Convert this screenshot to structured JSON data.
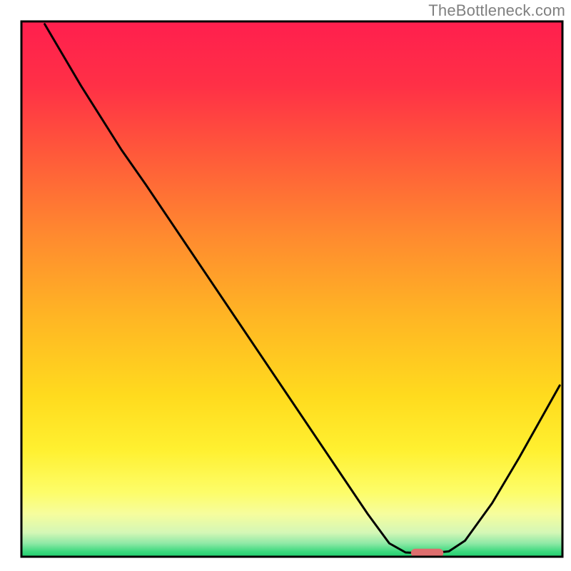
{
  "watermark": "TheBottleneck.com",
  "chart_data": {
    "type": "line",
    "title": "",
    "xlabel": "",
    "ylabel": "",
    "xlim": [
      0,
      100
    ],
    "ylim": [
      0,
      100
    ],
    "background_gradient": {
      "stops": [
        {
          "offset": 0.0,
          "color": "#ff1f4e"
        },
        {
          "offset": 0.12,
          "color": "#ff3046"
        },
        {
          "offset": 0.25,
          "color": "#ff5a3a"
        },
        {
          "offset": 0.4,
          "color": "#ff8a2f"
        },
        {
          "offset": 0.55,
          "color": "#ffb524"
        },
        {
          "offset": 0.7,
          "color": "#ffdb1e"
        },
        {
          "offset": 0.8,
          "color": "#fff030"
        },
        {
          "offset": 0.88,
          "color": "#fdfd69"
        },
        {
          "offset": 0.92,
          "color": "#f6fd9d"
        },
        {
          "offset": 0.955,
          "color": "#d4f7b6"
        },
        {
          "offset": 0.975,
          "color": "#8fe9a6"
        },
        {
          "offset": 0.99,
          "color": "#3ed97f"
        },
        {
          "offset": 1.0,
          "color": "#20cf6e"
        }
      ]
    },
    "curve": [
      {
        "x": 4.3,
        "y": 99.5
      },
      {
        "x": 11.0,
        "y": 88.0
      },
      {
        "x": 18.5,
        "y": 76.0
      },
      {
        "x": 23.0,
        "y": 69.5
      },
      {
        "x": 30.0,
        "y": 59.0
      },
      {
        "x": 40.0,
        "y": 44.0
      },
      {
        "x": 50.0,
        "y": 29.0
      },
      {
        "x": 58.0,
        "y": 17.0
      },
      {
        "x": 64.0,
        "y": 8.0
      },
      {
        "x": 68.0,
        "y": 2.5
      },
      {
        "x": 71.0,
        "y": 0.8
      },
      {
        "x": 75.0,
        "y": 0.6
      },
      {
        "x": 79.0,
        "y": 1.0
      },
      {
        "x": 82.0,
        "y": 3.0
      },
      {
        "x": 87.0,
        "y": 10.0
      },
      {
        "x": 92.0,
        "y": 18.5
      },
      {
        "x": 97.0,
        "y": 27.5
      },
      {
        "x": 99.5,
        "y": 32.0
      }
    ],
    "marker": {
      "x": 75.0,
      "y": 0.7,
      "width": 6.0,
      "height": 1.6,
      "color": "#de6e6e"
    },
    "frame_color": "#000000",
    "curve_color": "#000000"
  }
}
